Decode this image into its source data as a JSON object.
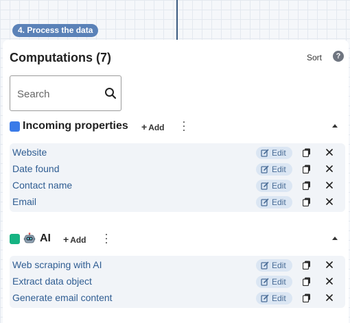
{
  "step_badge": "4. Process the data",
  "panel": {
    "title": "Computations (7)",
    "sort_label": "Sort",
    "help_label": "?"
  },
  "search": {
    "placeholder": "Search"
  },
  "colors": {
    "incoming_swatch": "#3b7be8",
    "ai_swatch": "#16b382",
    "link": "#2f5d92"
  },
  "sections": {
    "incoming": {
      "title": "Incoming properties",
      "add_label": "Add",
      "items": [
        {
          "label": "Website",
          "edit_label": "Edit"
        },
        {
          "label": "Date found",
          "edit_label": "Edit"
        },
        {
          "label": "Contact name",
          "edit_label": "Edit"
        },
        {
          "label": "Email",
          "edit_label": "Edit"
        }
      ]
    },
    "ai": {
      "title": "AI",
      "icon": "robot-icon",
      "add_label": "Add",
      "items": [
        {
          "label": "Web scraping with AI",
          "edit_label": "Edit"
        },
        {
          "label": "Extract data object",
          "edit_label": "Edit"
        },
        {
          "label": "Generate email content",
          "edit_label": "Edit"
        }
      ]
    }
  }
}
